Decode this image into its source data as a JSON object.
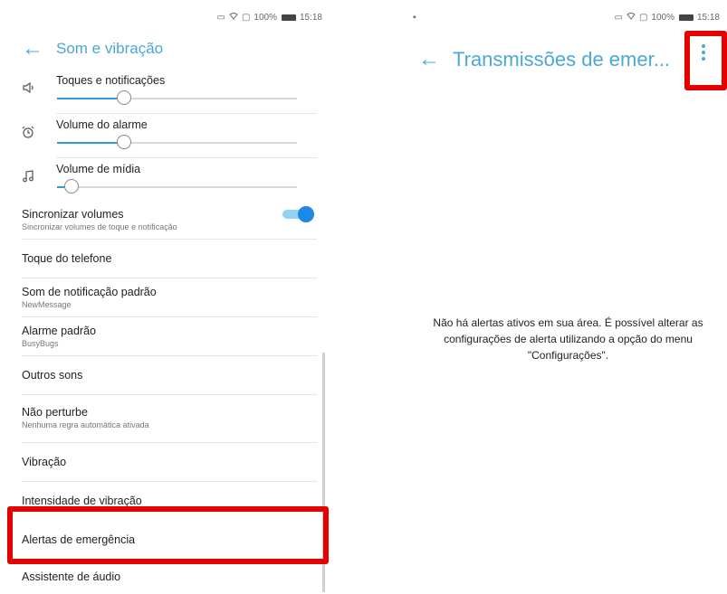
{
  "left_screen": {
    "status": {
      "battery": "100%",
      "time": "15:18"
    },
    "title": "Som e vibração",
    "volumes": [
      {
        "label": "Toques e notificações",
        "icon": "speaker-icon",
        "level": 0.28
      },
      {
        "label": "Volume do alarme",
        "icon": "alarm-clock-icon",
        "level": 0.28
      },
      {
        "label": "Volume de mídia",
        "icon": "music-note-icon",
        "level": 0.06
      }
    ],
    "sync": {
      "title": "Sincronizar volumes",
      "subtitle": "Sincronizar volumes de toque e notificação",
      "enabled": true
    },
    "items": [
      {
        "title": "Toque do telefone",
        "subtitle": ""
      },
      {
        "title": "Som de notificação padrão",
        "subtitle": "NewMessage"
      },
      {
        "title": "Alarme padrão",
        "subtitle": "BusyBugs"
      },
      {
        "title": "Outros sons",
        "subtitle": ""
      },
      {
        "title": "Não perturbe",
        "subtitle": "Nenhuma regra automática ativada"
      },
      {
        "title": "Vibração",
        "subtitle": ""
      },
      {
        "title": "Intensidade de vibração",
        "subtitle": ""
      },
      {
        "title": "Alertas de emergência",
        "subtitle": ""
      },
      {
        "title": "Assistente de áudio",
        "subtitle": ""
      }
    ]
  },
  "right_screen": {
    "status": {
      "battery": "100%",
      "time": "15:18"
    },
    "title": "Transmissões de emer...",
    "message": "Não há alertas ativos em sua área. É possível alterar as configurações de alerta utilizando a opção do menu \"Configurações\"."
  },
  "colors": {
    "accent": "#4aa8d8",
    "highlight": "#e60000",
    "toggle_on": "#1e88e5"
  }
}
